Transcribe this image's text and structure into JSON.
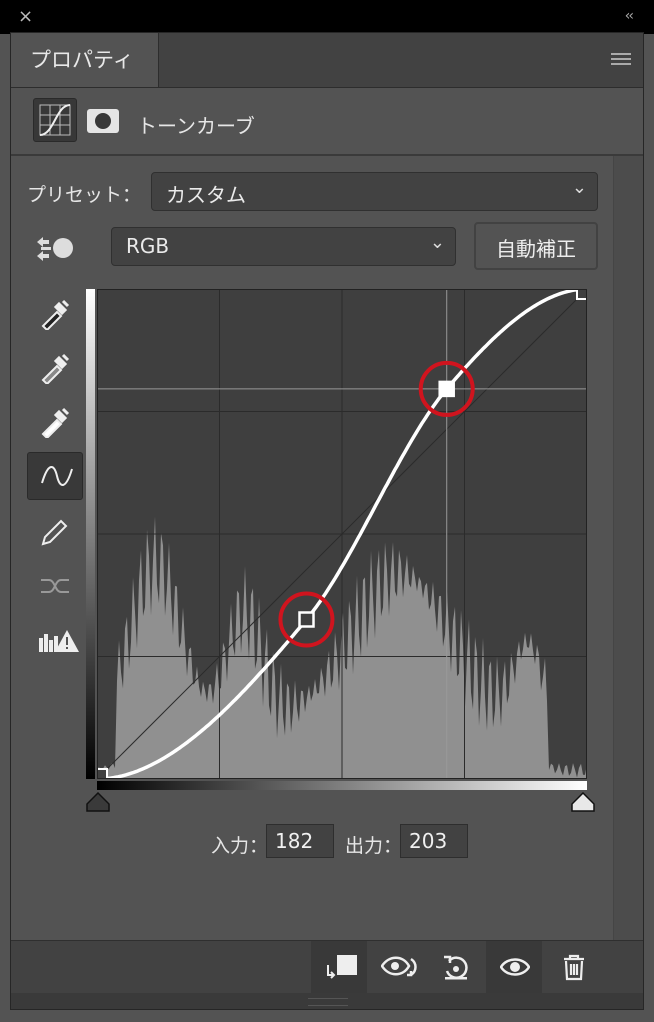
{
  "window": {
    "close_icon": "×",
    "collapse_icon": "‹‹"
  },
  "tab": {
    "label": "プロパティ"
  },
  "adjustment": {
    "title": "トーンカーブ"
  },
  "preset": {
    "label": "プリセット：",
    "value": "カスタム"
  },
  "channel": {
    "value": "RGB"
  },
  "auto_button": {
    "label": "自動補正"
  },
  "tools": [
    "eyedropper-black-icon",
    "eyedropper-gray-icon",
    "eyedropper-white-icon",
    "curve-point-icon",
    "pencil-icon",
    "smooth-icon",
    "clipping-warning-icon"
  ],
  "curve": {
    "points": [
      {
        "input": 0,
        "output": 0
      },
      {
        "input": 109,
        "output": 83
      },
      {
        "input": 182,
        "output": 203
      },
      {
        "input": 255,
        "output": 255
      }
    ],
    "selected_point_index": 2,
    "highlight_color": "#d0141e"
  },
  "io": {
    "input_label": "入力：",
    "input_value": "182",
    "output_label": "出力：",
    "output_value": "203"
  },
  "bottom_bar": [
    "clip-to-layer-icon",
    "view-previous-icon",
    "reset-icon",
    "visibility-icon",
    "trash-icon"
  ]
}
